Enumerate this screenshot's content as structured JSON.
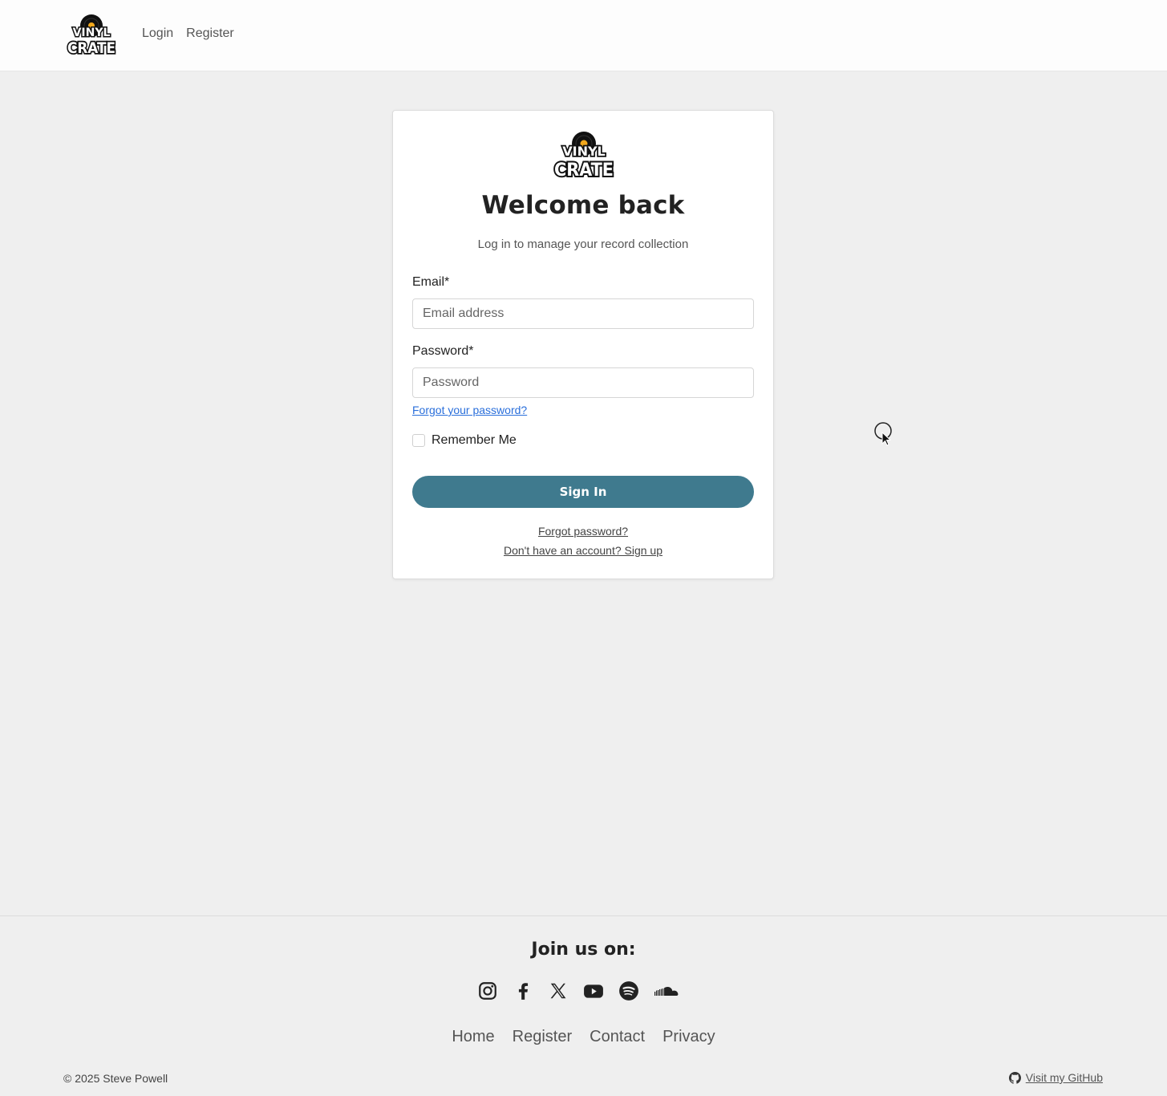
{
  "brand": {
    "logo_text_top": "VINYL",
    "logo_text_bottom": "CRATE"
  },
  "nav": {
    "login": "Login",
    "register": "Register"
  },
  "login_card": {
    "title": "Welcome back",
    "subtitle": "Log in to manage your record collection",
    "email_label": "Email*",
    "email_placeholder": "Email address",
    "email_value": "",
    "password_label": "Password*",
    "password_placeholder": "Password",
    "password_value": "",
    "forgot_inline": "Forgot your password?",
    "remember_label": "Remember Me",
    "remember_checked": false,
    "submit_label": "Sign In",
    "forgot_link": "Forgot password?",
    "signup_link": "Don't have an account? Sign up"
  },
  "footer": {
    "join_title": "Join us on:",
    "social": [
      "instagram-icon",
      "facebook-icon",
      "x-icon",
      "youtube-icon",
      "spotify-icon",
      "soundcloud-icon"
    ],
    "links": [
      "Home",
      "Register",
      "Contact",
      "Privacy"
    ],
    "copyright": "© 2025 Steve Powell",
    "github_label": "Visit my GitHub"
  },
  "colors": {
    "accent": "#3f7a8e",
    "link": "#2a6fdb",
    "page_bg": "#efefef",
    "logo_orange": "#f2a81d"
  }
}
